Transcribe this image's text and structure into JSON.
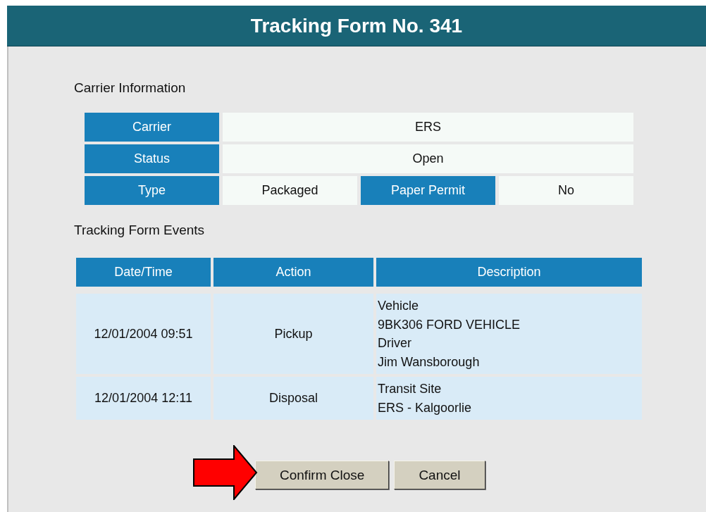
{
  "header": {
    "title": "Tracking Form No. 341"
  },
  "carrier_information": {
    "title": "Carrier Information",
    "rows": [
      [
        {
          "kind": "label",
          "text": "Carrier"
        },
        {
          "kind": "value",
          "text": "ERS"
        }
      ],
      [
        {
          "kind": "label",
          "text": "Status"
        },
        {
          "kind": "value",
          "text": "Open"
        }
      ],
      [
        {
          "kind": "label",
          "text": "Type"
        },
        {
          "kind": "value",
          "text": "Packaged"
        },
        {
          "kind": "label",
          "text": "Paper Permit"
        },
        {
          "kind": "value",
          "text": "No"
        }
      ]
    ]
  },
  "events": {
    "title": "Tracking Form Events",
    "columns": [
      "Date/Time",
      "Action",
      "Description"
    ],
    "rows": [
      {
        "date_time": "12/01/2004 09:51",
        "action": "Pickup",
        "description": [
          "Vehicle",
          "9BK306 FORD VEHICLE",
          "Driver",
          "Jim Wansborough"
        ]
      },
      {
        "date_time": "12/01/2004 12:11",
        "action": "Disposal",
        "description": [
          "Transit Site",
          "ERS - Kalgoorlie"
        ]
      }
    ]
  },
  "buttons": [
    {
      "label": "Confirm Close",
      "highlighted": true
    },
    {
      "label": "Cancel",
      "highlighted": false
    }
  ]
}
